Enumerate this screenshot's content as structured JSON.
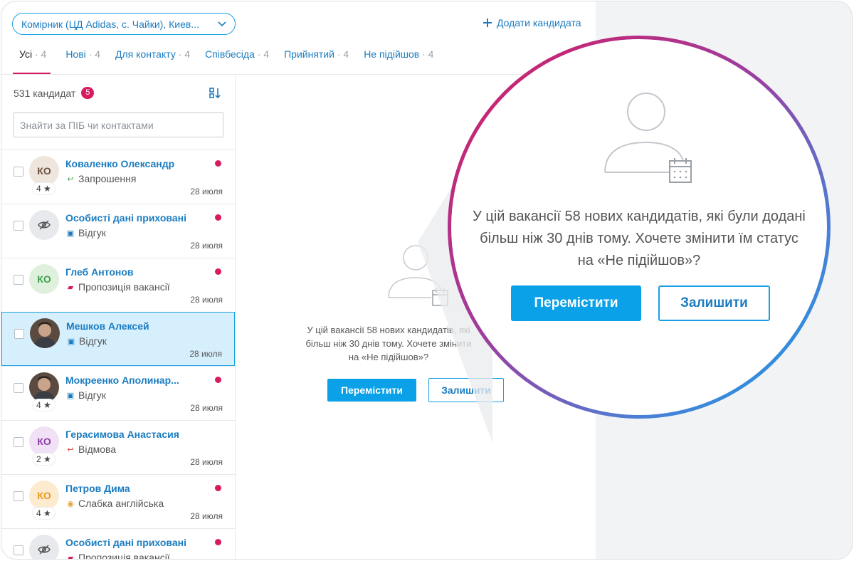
{
  "header": {
    "vacancy_select": "Комірник (ЦД Adidas, с. Чайки),  Киев...",
    "add_candidate": "Додати кандидата"
  },
  "tabs": [
    {
      "label": "Усі",
      "count": "· 4",
      "active": true
    },
    {
      "label": "Нові",
      "count": "· 4"
    },
    {
      "label": "Для контакту",
      "count": "· 4"
    },
    {
      "label": "Співбесіда",
      "count": "· 4"
    },
    {
      "label": "Прийнятий",
      "count": "· 4"
    },
    {
      "label": "Не підійшов",
      "count": "· 4"
    }
  ],
  "sidebar": {
    "count_label": "531 кандидат",
    "badge": "5",
    "search_placeholder": "Знайти за ПІБ чи контактами"
  },
  "candidates": [
    {
      "name": "Коваленко Олександр",
      "initials": "КО",
      "rating": "4 ★",
      "status": "Запрошення",
      "status_icon": "reply-icon",
      "status_color": "#3fa14a",
      "date": "28 июля",
      "unread": true,
      "avatar_bg": "#eee5dc",
      "avatar_fg": "#6b5140"
    },
    {
      "name": "Особисті дані приховані",
      "initials": "",
      "rating": "",
      "status": "Відгук",
      "status_icon": "document-icon",
      "status_color": "#1b7cc0",
      "date": "28 июля",
      "unread": true,
      "avatar_bg": "#e7e9ec",
      "avatar_fg": "#555",
      "hidden": true
    },
    {
      "name": "Глеб Антонов",
      "initials": "КО",
      "rating": "",
      "status": "Пропозиція вакансії",
      "status_icon": "briefcase-icon",
      "status_color": "#d81b60",
      "date": "28 июля",
      "unread": true,
      "avatar_bg": "#dff1dc",
      "avatar_fg": "#3fa14a"
    },
    {
      "name": "Мешков Алексей",
      "initials": "",
      "rating": "",
      "status": "Відгук",
      "status_icon": "document-icon",
      "status_color": "#1b7cc0",
      "date": "28 июля",
      "unread": false,
      "photo": true,
      "selected": true
    },
    {
      "name": "Мокреенко Аполинар...",
      "initials": "",
      "rating": "4 ★",
      "status": "Відгук",
      "status_icon": "document-icon",
      "status_color": "#1b7cc0",
      "date": "28 июля",
      "unread": true,
      "photo": true
    },
    {
      "name": "Герасимова Анастасия",
      "initials": "КО",
      "rating": "2 ★",
      "status": "Відмова",
      "status_icon": "reply-icon",
      "status_color": "#e53935",
      "date": "28 июля",
      "unread": false,
      "avatar_bg": "#f0e1f6",
      "avatar_fg": "#8e3aa8"
    },
    {
      "name": "Петров Дима",
      "initials": "КО",
      "rating": "4 ★",
      "status": "Слабка англійська",
      "status_icon": "comment-icon",
      "status_color": "#e6a23c",
      "date": "28 июля",
      "unread": true,
      "avatar_bg": "#fdebd0",
      "avatar_fg": "#e39a1f"
    },
    {
      "name": "Особисті дані приховані",
      "initials": "",
      "rating": "",
      "status": "Пропозиція вакансії",
      "status_icon": "briefcase-icon",
      "status_color": "#d81b60",
      "date": "",
      "unread": true,
      "avatar_bg": "#e7e9ec",
      "avatar_fg": "#555",
      "hidden": true
    }
  ],
  "prompt": {
    "message": "У цій вакансії 58 нових кандидатів, які були додані більш ніж 30 днів тому. Хочете змінити їм статус на «Не підійшов»?",
    "message_lines": [
      "У цій вакансії 58 нових кандидатів, які були додані",
      "більш ніж 30 днів тому. Хочете змінити їм статус",
      "на «Не підійшов»?"
    ],
    "small_lines": [
      "У цій вакансії 58 нових кандидатів, які",
      "більш ніж 30 днів тому. Хочете змінити",
      "на «Не підійшов»?"
    ],
    "move_button": "Перемістити",
    "keep_button": "Залишити"
  },
  "colors": {
    "accent": "#1aa0e4",
    "brand_pink": "#d81b60",
    "link": "#1b7cc0"
  }
}
